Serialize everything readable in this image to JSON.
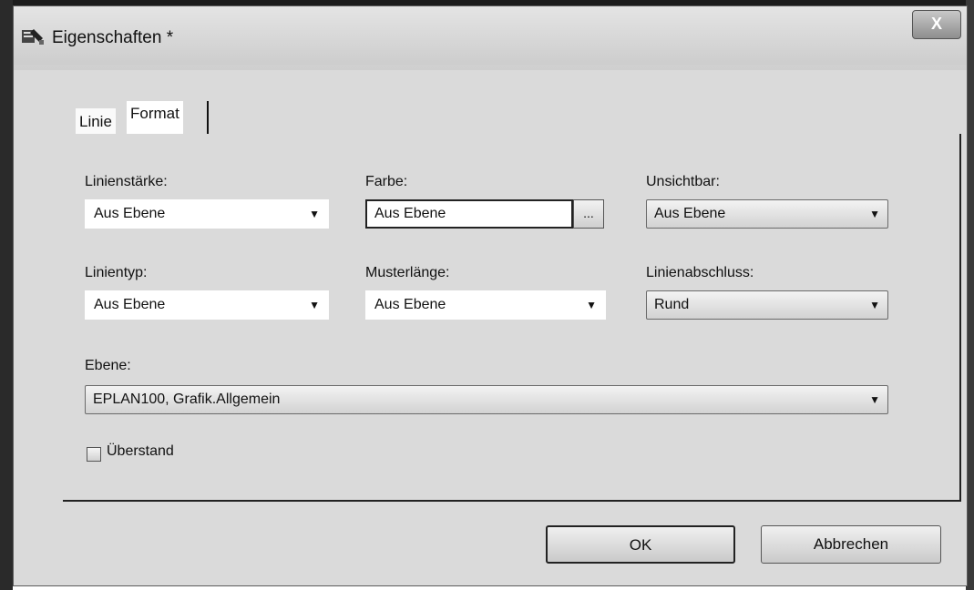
{
  "window": {
    "title": "Eigenschaften *",
    "close_label": "X"
  },
  "tabs": [
    {
      "label": "Linie"
    },
    {
      "label": "Format"
    }
  ],
  "fields": {
    "linienstaerke": {
      "label": "Linienstärke:",
      "value": "Aus Ebene"
    },
    "farbe": {
      "label": "Farbe:",
      "value": "Aus Ebene",
      "button_label": "..."
    },
    "unsichtbar": {
      "label": "Unsichtbar:",
      "value": "Aus Ebene"
    },
    "linientyp": {
      "label": "Linientyp:",
      "value": "Aus Ebene"
    },
    "musterlaenge": {
      "label": "Musterlänge:",
      "value": "Aus Ebene"
    },
    "linienabschluss": {
      "label": "Linienabschluss:",
      "value": "Rund"
    },
    "ebene": {
      "label": "Ebene:",
      "value": "EPLAN100, Grafik.Allgemein"
    }
  },
  "checkbox": {
    "label": "Überstand",
    "checked": false
  },
  "buttons": {
    "ok": "OK",
    "cancel": "Abbrechen"
  },
  "icons": {
    "app": "properties-icon",
    "dropdown": "chevron-down-icon"
  }
}
